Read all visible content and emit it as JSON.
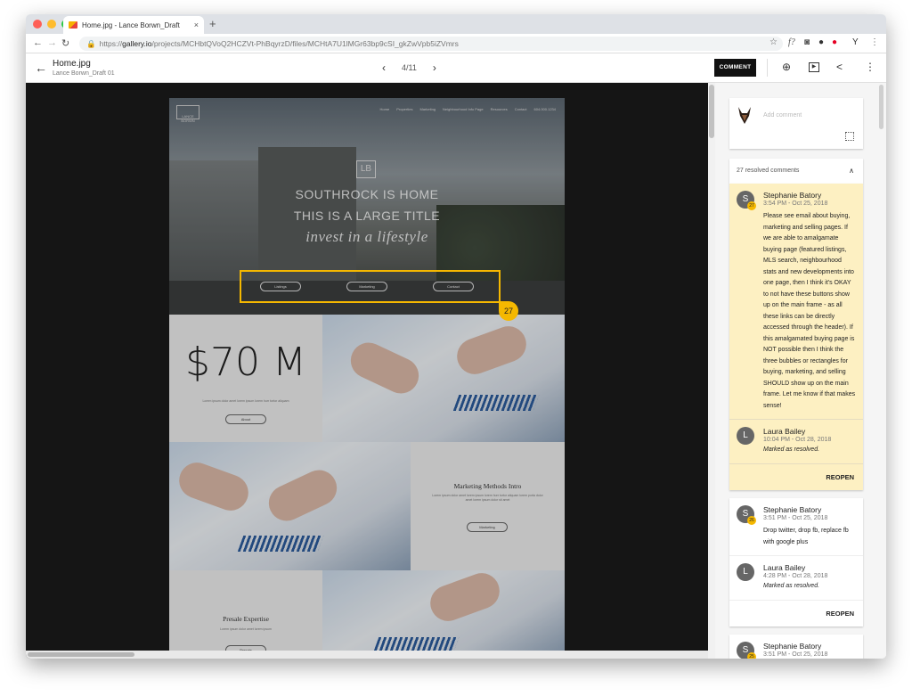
{
  "browser": {
    "tab_title": "Home.jpg - Lance Borwn_Draft",
    "tab_close": "×",
    "new_tab": "+",
    "url_prefix": "https://",
    "url_host": "gallery.io",
    "url_path": "/projects/MCHbtQVoQ2HCZVt-PhBqyrzD/files/MCHtA7U1lMGr63bp9cSI_gkZwVpb5iZVmrs",
    "window_dots": [
      "#fe5f57",
      "#febc2e",
      "#28c840"
    ]
  },
  "header": {
    "file_title": "Home.jpg",
    "file_subtitle": "Lance Borwn_Draft 01",
    "page_indicator": "4/11",
    "comment_button": "COMMENT"
  },
  "mockup": {
    "logo_text": "LANCE BORWN",
    "nav": [
      "Home",
      "Properties",
      "Marketing",
      "Neighbourhood Info Page",
      "Resources",
      "Contact",
      "604.000.1234"
    ],
    "hero_logo": "LB",
    "hero_line1": "SOUTHROCK IS HOME",
    "hero_line2": "THIS IS A LARGE TITLE",
    "hero_line3": "invest in a lifestyle",
    "hero_buttons": [
      "Listings",
      "Marketing",
      "Contact"
    ],
    "pin_number": "27",
    "stat": "$70 M",
    "stat_text": "Lorem ipsum dolor amet lorem ipsum lorem hurr tortor aliquam",
    "about_button": "About",
    "marketing_title": "Marketing Methods Intro",
    "marketing_text": "Lorem ipsum dolor amet lorem ipsum lorem hurr tortor aliquam lorem porta dolor amet lorem ipsum dolor sit amet",
    "marketing_button": "Marketing",
    "presale_title": "Presale Expertise",
    "presale_text": "Lorem ipsum dolor amet lorem ipsum",
    "presale_button": "Presale"
  },
  "panel": {
    "add_comment_placeholder": "Add comment",
    "resolved_count_label": "27 resolved comments",
    "comments": [
      {
        "author": "Stephanie Batory",
        "initial": "S",
        "badge": "27",
        "time": "3:54 PM - Oct 25, 2018",
        "text": "Please see email about buying, marketing and selling pages. If we are able to amalgamate buying page (featured listings, MLS search, neighbourhood stats and new developments into one page, then I think it's OKAY to not have these buttons show up on the main frame - as all these links can be directly accessed through the header). If this amalgamated buying page is NOT possible then I think the three bubbles or rectangles for buying, marketing, and selling SHOULD show up on the main frame. Let me know if that makes sense!",
        "reply_author": "Laura Bailey",
        "reply_initial": "L",
        "reply_time": "10:04 PM - Oct 28, 2018",
        "reply_text": "Marked as resolved.",
        "action": "REOPEN"
      },
      {
        "author": "Stephanie Batory",
        "initial": "S",
        "badge": "26",
        "time": "3:51 PM - Oct 25, 2018",
        "text": "Drop twitter, drop fb, replace fb with google plus",
        "reply_author": "Laura Bailey",
        "reply_initial": "L",
        "reply_time": "4:28 PM - Oct 28, 2018",
        "reply_text": "Marked as resolved.",
        "action": "REOPEN"
      },
      {
        "author": "Stephanie Batory",
        "initial": "S",
        "badge": "25",
        "time": "3:51 PM - Oct 25, 2018"
      }
    ]
  },
  "colors": {
    "accent": "#f5b800",
    "active_card": "#fdf0c2",
    "canvas": "#151515"
  }
}
